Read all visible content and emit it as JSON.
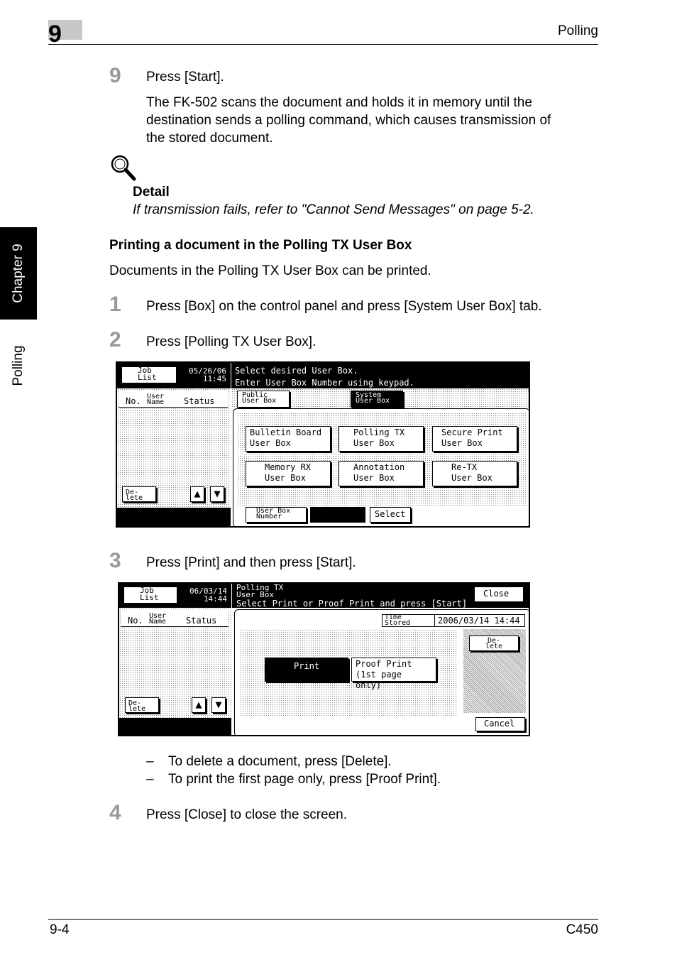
{
  "header": {
    "chapter_number": "9",
    "section_title": "Polling"
  },
  "side_tab": {
    "chapter_label": "Chapter 9",
    "section_label": "Polling"
  },
  "step9": {
    "number": "9",
    "text": "Press [Start].",
    "para1": "The FK-502 scans the document and holds it in memory until the",
    "para2": "destination sends a polling command, which causes transmission of",
    "para3": "the stored document."
  },
  "detail": {
    "icon": "magnifier-icon",
    "title": "Detail",
    "text": "If transmission fails, refer to \"Cannot Send Messages\" on page 5-2."
  },
  "section": {
    "heading": "Printing a document in the Polling TX User Box",
    "intro": "Documents in the Polling TX User Box can be printed."
  },
  "steps": [
    {
      "number": "1",
      "text": "Press [Box] on the control panel and press [System User Box] tab."
    },
    {
      "number": "2",
      "text": "Press [Polling TX User Box]."
    },
    {
      "number": "3",
      "text": "Press [Print] and then press [Start]."
    },
    {
      "number": "4",
      "text": "Press [Close] to close the screen."
    }
  ],
  "bullets": [
    {
      "dash": "–",
      "text": "To delete a document, press [Delete]."
    },
    {
      "dash": "–",
      "text": "To print the first page only, press [Proof Print]."
    }
  ],
  "screen1": {
    "job_list": [
      "Job",
      "List"
    ],
    "date": "05/26/06",
    "time": "11:45",
    "msg1": "Select desired User Box.",
    "msg2": "Enter User Box Number using keypad.",
    "col_no": "No.",
    "col_user": [
      "User",
      "Name"
    ],
    "col_status": "Status",
    "tab_public": [
      "Public",
      "User Box"
    ],
    "tab_system": [
      "System",
      "User Box"
    ],
    "buttons": [
      [
        "Bulletin Board",
        "User Box"
      ],
      [
        "Polling TX",
        "User Box"
      ],
      [
        "Secure Print",
        "User Box"
      ],
      [
        "Memory RX",
        "User Box"
      ],
      [
        "Annotation",
        "User Box"
      ],
      [
        "Re-TX",
        "User Box"
      ]
    ],
    "delete": [
      "De-",
      "lete"
    ],
    "up_arrow": "▲",
    "down_arrow": "▼",
    "user_box_number": [
      "User Box",
      "Number"
    ],
    "select": "Select"
  },
  "screen2": {
    "job_list": [
      "Job",
      "List"
    ],
    "date": "06/03/14",
    "time": "14:44",
    "title1": "Polling TX",
    "title2": "User Box",
    "msg": "Select Print or Proof Print and press [Start]",
    "close": "Close",
    "col_no": "No.",
    "col_user": [
      "User",
      "Name"
    ],
    "col_status": "Status",
    "time_stored_label": [
      "Time",
      "Stored"
    ],
    "time_stored_value": "2006/03/14 14:44",
    "delete_right": [
      "De-",
      "lete"
    ],
    "print": "Print",
    "proof_print": [
      "Proof Print",
      "(1st page only)"
    ],
    "delete_left": [
      "De-",
      "lete"
    ],
    "up_arrow": "▲",
    "down_arrow": "▼",
    "cancel": "Cancel"
  },
  "footer": {
    "page": "9-4",
    "model": "C450"
  }
}
